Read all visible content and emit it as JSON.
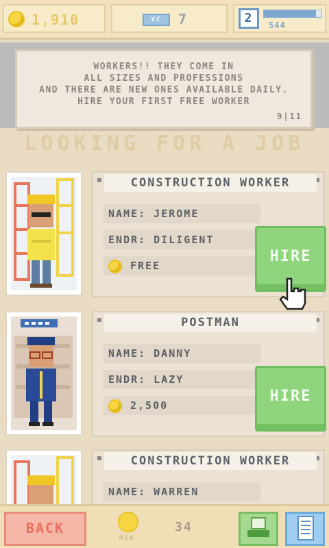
{
  "topbar": {
    "coins": "1,910",
    "vc_card_label": "VC",
    "vc_value": "7",
    "level": "2",
    "xp_value": "544",
    "xp_progress": 0.9
  },
  "tutorial": {
    "lines": [
      "WORKERS!! THEY COME IN",
      "ALL SIZES AND PROFESSIONS",
      "AND THERE ARE NEW ONES AVAILABLE DAILY.",
      "HIRE YOUR FIRST FREE WORKER"
    ],
    "page": "9|11"
  },
  "heading": "LOOKING FOR A JOB",
  "jobs": [
    {
      "title": "CONSTRUCTION WORKER",
      "name": "NAME: JEROME",
      "trait": "ENDR: DILIGENT",
      "price": "FREE",
      "hire_label": "HIRE"
    },
    {
      "title": "POSTMAN",
      "name": "NAME: DANNY",
      "trait": "ENDR: LAZY",
      "price": "2,500",
      "hire_label": "HIRE"
    },
    {
      "title": "CONSTRUCTION WORKER",
      "name": "NAME: WARREN"
    }
  ],
  "bottombar": {
    "back_label": "BACK",
    "min_label": "MIN",
    "min_value": "34"
  },
  "colors": {
    "hire_green": "#8fd57e",
    "back_red": "#f5b8a8",
    "coin_gold": "#f6d743"
  }
}
